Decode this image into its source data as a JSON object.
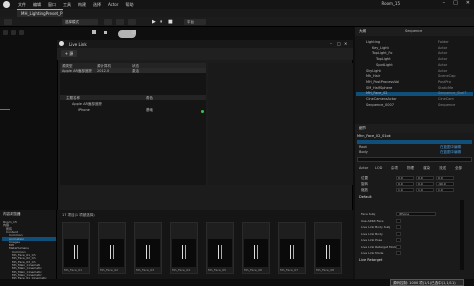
{
  "menu": {
    "items": [
      "文件",
      "编辑",
      "窗口",
      "工具",
      "构建",
      "选择",
      "Actor",
      "帮助"
    ]
  },
  "window": {
    "title": "Room_15",
    "tab": "MH_LightingPreset_P"
  },
  "toolbar": {
    "mode_label": "选择模式",
    "platform_label": "平台"
  },
  "livelink": {
    "title": "Live Link",
    "source_button": "+ 源",
    "source_headers": [
      "源类型",
      "源计算机",
      "状态"
    ],
    "sources": [
      {
        "type": "Apple AR面部追踪",
        "machine": "2012.0",
        "status": "激活"
      }
    ],
    "subject_headers": [
      "主题名称",
      "角色"
    ],
    "subjects": [
      {
        "name": "Apple AR面部追踪",
        "role": ""
      },
      {
        "name": "iPhone",
        "role": "基础"
      }
    ]
  },
  "content_browser": {
    "count_text": "17 项目(1 项被选择)",
    "items": [
      "Mh_Face_01",
      "Mh_Face_02",
      "Mh_Face_03",
      "Mh_Face_04",
      "Mh_Face_05",
      "Mh_Face_06",
      "Mh_Face_07",
      "Mh_Face_08"
    ]
  },
  "left_panel": {
    "title": "内容浏览器",
    "rows": [
      "Room_15",
      "内容",
      "所有",
      "Content",
      "Common",
      "Animation",
      "Images",
      "MH",
      "MetaHumans",
      "Common",
      "Mh_Face_01_Ch",
      "Mh_Face_02_Ch",
      "Mh_Face_03_Ch",
      "Mh_Main_Cinemati",
      "Mh_Main_Cinematic",
      "Mh_Main_Cinematic",
      "Mh_Main_Cinematic",
      "Mh_Face_01_Cinematic"
    ],
    "selected_index": 5,
    "collections_label": "集合"
  },
  "outliner": {
    "title": "大纲",
    "type_header": "Sequence",
    "rows": [
      {
        "name": "Lighting",
        "type": "Folder"
      },
      {
        "name": "Key_Light",
        "type": "Actor"
      },
      {
        "name": "TopLight_Fo",
        "type": "Actor"
      },
      {
        "name": "TopLight",
        "type": "Actor"
      },
      {
        "name": "SpotLight",
        "type": "Actor"
      },
      {
        "name": "SkyLight",
        "type": "Actor"
      },
      {
        "name": "Mh_Hair",
        "type": "SceneCap"
      },
      {
        "name": "MH_PostProcessVol",
        "type": "PostPro"
      },
      {
        "name": "SM_HalfSphere",
        "type": "StaticMe"
      },
      {
        "name": "MH_Face_02",
        "type": "Sequence_SkelT"
      },
      {
        "name": "CineCameraActor",
        "type": "CineCam"
      },
      {
        "name": "Sequence_0007",
        "type": "Sequence"
      }
    ],
    "selected_index": 9
  },
  "details": {
    "title": "细节",
    "actor_name": "Mhn_Face_02_01ok",
    "rows": [
      {
        "label": "Root",
        "value": "在蓝图中编辑"
      },
      {
        "label": "Body",
        "value": "在蓝图中编辑"
      }
    ],
    "tabs": [
      "Actor",
      "LOD",
      "杂项",
      "物理",
      "渲染",
      "流送",
      "全部"
    ],
    "transform_labels": [
      "位置",
      "旋转",
      "缩放"
    ],
    "transform_values": [
      [
        "0.0",
        "0.0",
        "0.0"
      ],
      [
        "0.0",
        "0.0",
        "-90.0"
      ],
      [
        "1.0",
        "1.0",
        "1.0"
      ]
    ],
    "livelink_rows": [
      "Face Subj",
      "Use ARKit Face",
      "Live Link Body Subj",
      "Live Link Body",
      "Live Link Pose",
      "Live Link Retarget Mode",
      "Live Link Mode"
    ],
    "face_subject_value": "iPhone",
    "section_labels": [
      "Default",
      "Live Retarget"
    ]
  },
  "status": {
    "text": "源码控制: 1000 项(1/1)已选中(1,1/11)"
  }
}
